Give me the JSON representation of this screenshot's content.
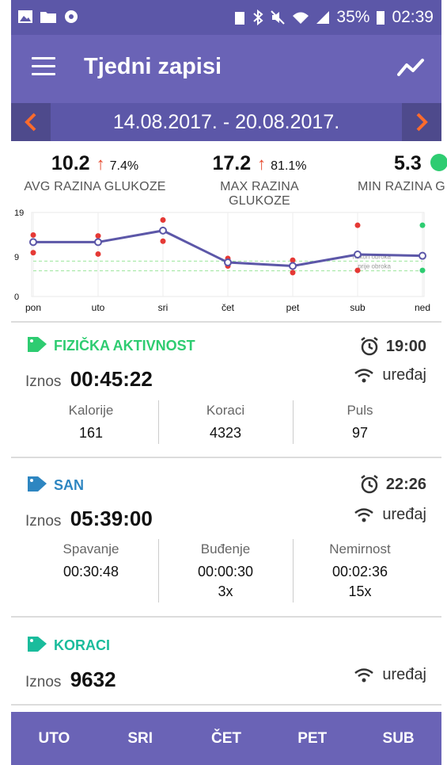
{
  "status_bar": {
    "battery": "35%",
    "time": "02:39"
  },
  "app_bar": {
    "title": "Tjedni zapisi"
  },
  "week_nav": {
    "date_range": "14.08.2017. - 20.08.2017."
  },
  "stats": [
    {
      "value": "10.2",
      "change": "7.4%",
      "label": "AVG RAZINA GLUKOZE"
    },
    {
      "value": "17.2",
      "change": "81.1%",
      "label": "MAX RAZINA GLUKOZE"
    },
    {
      "value": "5.3",
      "label": "MIN RAZINA G"
    }
  ],
  "chart_data": {
    "type": "line",
    "categories": [
      "pon",
      "uto",
      "sri",
      "čet",
      "pet",
      "sub",
      "ned"
    ],
    "ylim": [
      0,
      19
    ],
    "yticks": [
      "0",
      "9",
      "19"
    ],
    "series": [
      {
        "values": [
          12.3,
          12.3,
          14.9,
          7.7,
          6.9,
          9.5,
          9.2
        ]
      }
    ],
    "points_red": [
      [
        0,
        13.9
      ],
      [
        0,
        9.9
      ],
      [
        1,
        13.7
      ],
      [
        1,
        9.6
      ],
      [
        2,
        17.3
      ],
      [
        2,
        12.5
      ],
      [
        3,
        8.6
      ],
      [
        3,
        6.9
      ],
      [
        4,
        8.2
      ],
      [
        4,
        5.4
      ],
      [
        5,
        16.1
      ],
      [
        5,
        5.9
      ]
    ],
    "points_green": [
      [
        6,
        16.1
      ],
      [
        6,
        5.9
      ]
    ],
    "reference_lines": [
      {
        "value": 8.0,
        "label": "nakon obroka"
      },
      {
        "value": 5.8,
        "label": "prije obroka"
      }
    ],
    "colors": {
      "line": "#5c57a8",
      "red": "#e53935",
      "green": "#2ecc71"
    }
  },
  "sections": {
    "activity": {
      "title": "FIZIČKA AKTIVNOST",
      "time": "19:00",
      "iznos_label": "Iznos",
      "iznos": "00:45:22",
      "device": "uređaj",
      "cells": [
        {
          "h": "Kalorije",
          "v": "161"
        },
        {
          "h": "Koraci",
          "v": "4323"
        },
        {
          "h": "Puls",
          "v": "97"
        }
      ],
      "color": "#2ecc71"
    },
    "sleep": {
      "title": "SAN",
      "time": "22:26",
      "iznos_label": "Iznos",
      "iznos": "05:39:00",
      "device": "uređaj",
      "cells": [
        {
          "h": "Spavanje",
          "v": "00:30:48",
          "v2": ""
        },
        {
          "h": "Buđenje",
          "v": "00:00:30",
          "v2": "3x"
        },
        {
          "h": "Nemirnost",
          "v": "00:02:36",
          "v2": "15x"
        }
      ],
      "color": "#2e86c1"
    },
    "steps": {
      "title": "KORACI",
      "iznos_label": "Iznos",
      "iznos": "9632",
      "device": "uređaj",
      "color": "#1abc9c"
    }
  },
  "bottom_nav": {
    "days": [
      "UTO",
      "SRI",
      "ČET",
      "PET",
      "SUB"
    ]
  }
}
